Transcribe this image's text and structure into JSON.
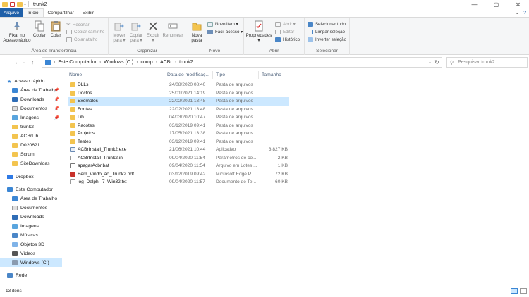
{
  "window": {
    "title": "trunk2",
    "controls": {
      "minimize": "—",
      "maximize": "▢",
      "close": "✕"
    }
  },
  "ribbon_tabs": {
    "file": "Arquivo",
    "home": "Início",
    "share": "Compartilhar",
    "view": "Exibir"
  },
  "ribbon": {
    "clipboard": {
      "label": "Área de Transferência",
      "pin": "Fixar no\nAcesso rápido",
      "copy": "Copiar",
      "paste": "Colar",
      "cut": "Recortar",
      "copy_path": "Copiar caminho",
      "paste_shortcut": "Colar atalho"
    },
    "organize": {
      "label": "Organizar",
      "move_to": "Mover\npara ▾",
      "copy_to": "Copiar\npara ▾",
      "delete": "Excluir\n▾",
      "rename": "Renomear"
    },
    "new": {
      "label": "Novo",
      "new_folder": "Nova\npasta",
      "new_item": "Novo item ▾",
      "easy_access": "Fácil acesso ▾"
    },
    "open": {
      "label": "Abrir",
      "properties": "Propriedades\n▾",
      "open": "Abrir ▾",
      "edit": "Editar",
      "history": "Histórico"
    },
    "select": {
      "label": "Selecionar",
      "select_all": "Selecionar tudo",
      "select_none": "Limpar seleção",
      "invert": "Inverter seleção"
    }
  },
  "address": {
    "crumbs": [
      "Este Computador",
      "Windows (C:)",
      "comp",
      "ACBr",
      "trunk2"
    ],
    "search_placeholder": "Pesquisar trunk2"
  },
  "nav": {
    "quick_access": "Acesso rápido",
    "items": [
      {
        "label": "Área de Trabalho",
        "pinned": true
      },
      {
        "label": "Downloads",
        "pinned": true
      },
      {
        "label": "Documentos",
        "pinned": true
      },
      {
        "label": "Imagens",
        "pinned": true
      },
      {
        "label": "trunk2",
        "pinned": false
      },
      {
        "label": "ACBrLib",
        "pinned": false
      },
      {
        "label": "D020621",
        "pinned": false
      },
      {
        "label": "Scrum",
        "pinned": false
      },
      {
        "label": "SiteDownloas",
        "pinned": false
      }
    ],
    "dropbox": "Dropbox",
    "this_pc": "Este Computador",
    "pc_items": [
      "Área de Trabalho",
      "Documentos",
      "Downloads",
      "Imagens",
      "Músicas",
      "Objetos 3D",
      "Vídeos",
      "Windows (C:)"
    ],
    "network": "Rede"
  },
  "columns": {
    "name": "Nome",
    "date": "Data de modificaç...",
    "type": "Tipo",
    "size": "Tamanho"
  },
  "files": [
    {
      "name": "DLLs",
      "date": "24/08/2020 08:40",
      "type": "Pasta de arquivos",
      "size": "",
      "icon": "folder-icon"
    },
    {
      "name": "Doctos",
      "date": "25/01/2021 14:19",
      "type": "Pasta de arquivos",
      "size": "",
      "icon": "folder-icon"
    },
    {
      "name": "Exemplos",
      "date": "22/02/2021 13:48",
      "type": "Pasta de arquivos",
      "size": "",
      "icon": "folder-icon"
    },
    {
      "name": "Fontes",
      "date": "22/02/2021 13:48",
      "type": "Pasta de arquivos",
      "size": "",
      "icon": "folder-icon"
    },
    {
      "name": "Lib",
      "date": "04/03/2020 10:47",
      "type": "Pasta de arquivos",
      "size": "",
      "icon": "folder-icon"
    },
    {
      "name": "Pacotes",
      "date": "03/12/2019 09:41",
      "type": "Pasta de arquivos",
      "size": "",
      "icon": "folder-icon"
    },
    {
      "name": "Projetos",
      "date": "17/05/2021 13:38",
      "type": "Pasta de arquivos",
      "size": "",
      "icon": "folder-icon"
    },
    {
      "name": "Testes",
      "date": "03/12/2019 09:41",
      "type": "Pasta de arquivos",
      "size": "",
      "icon": "folder-icon"
    },
    {
      "name": "ACBrInstall_Trunk2.exe",
      "date": "21/06/2021 10:44",
      "type": "Aplicativo",
      "size": "3.827 KB",
      "icon": "exe-icon"
    },
    {
      "name": "ACBrInstall_Trunk2.ini",
      "date": "09/04/2020 11:54",
      "type": "Parâmetros de co...",
      "size": "2 KB",
      "icon": "ini-icon"
    },
    {
      "name": "apagarAcbr.bat",
      "date": "09/04/2020 11:54",
      "type": "Arquivo em Lotes ...",
      "size": "1 KB",
      "icon": "bat-icon"
    },
    {
      "name": "Bem_Vindo_ao_Trunk2.pdf",
      "date": "03/12/2019 09:42",
      "type": "Microsoft Edge P...",
      "size": "72 KB",
      "icon": "pdf-icon"
    },
    {
      "name": "log_Delphi_7_Win32.txt",
      "date": "09/04/2020 11:57",
      "type": "Documento de Te...",
      "size": "60 KB",
      "icon": "txt-icon"
    }
  ],
  "selected_file_index": 2,
  "status": {
    "count": "13 itens"
  },
  "colors": {
    "accent": "#1f5fa8",
    "selection": "#cce8ff",
    "folder": "#f3c44f"
  }
}
